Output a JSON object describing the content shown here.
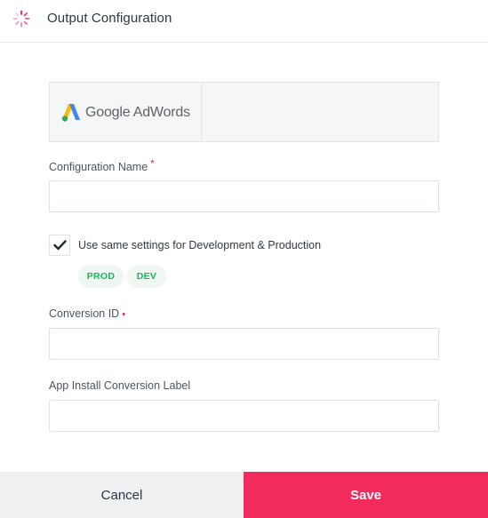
{
  "header": {
    "title": "Output Configuration",
    "icon": "loading-spinner-icon",
    "accent_color": "#e91e63"
  },
  "integration": {
    "logo_text": "Google AdWords",
    "logo_icon": "google-adwords-logo-icon",
    "logo_colors": [
      "#fbbc04",
      "#4285f4",
      "#34a853"
    ]
  },
  "form": {
    "configuration_name": {
      "label": "Configuration Name",
      "required_marker": "*",
      "value": "",
      "placeholder": ""
    },
    "same_settings": {
      "label": "Use same settings for Development & Production",
      "checked": true
    },
    "environments": [
      "PROD",
      "DEV"
    ],
    "conversion_id": {
      "label": "Conversion ID",
      "required_marker": "•",
      "value": "",
      "placeholder": ""
    },
    "app_install_label": {
      "label": "App Install Conversion Label",
      "value": "",
      "placeholder": ""
    }
  },
  "footer": {
    "cancel_label": "Cancel",
    "save_label": "Save",
    "save_color": "#f22b5d"
  }
}
